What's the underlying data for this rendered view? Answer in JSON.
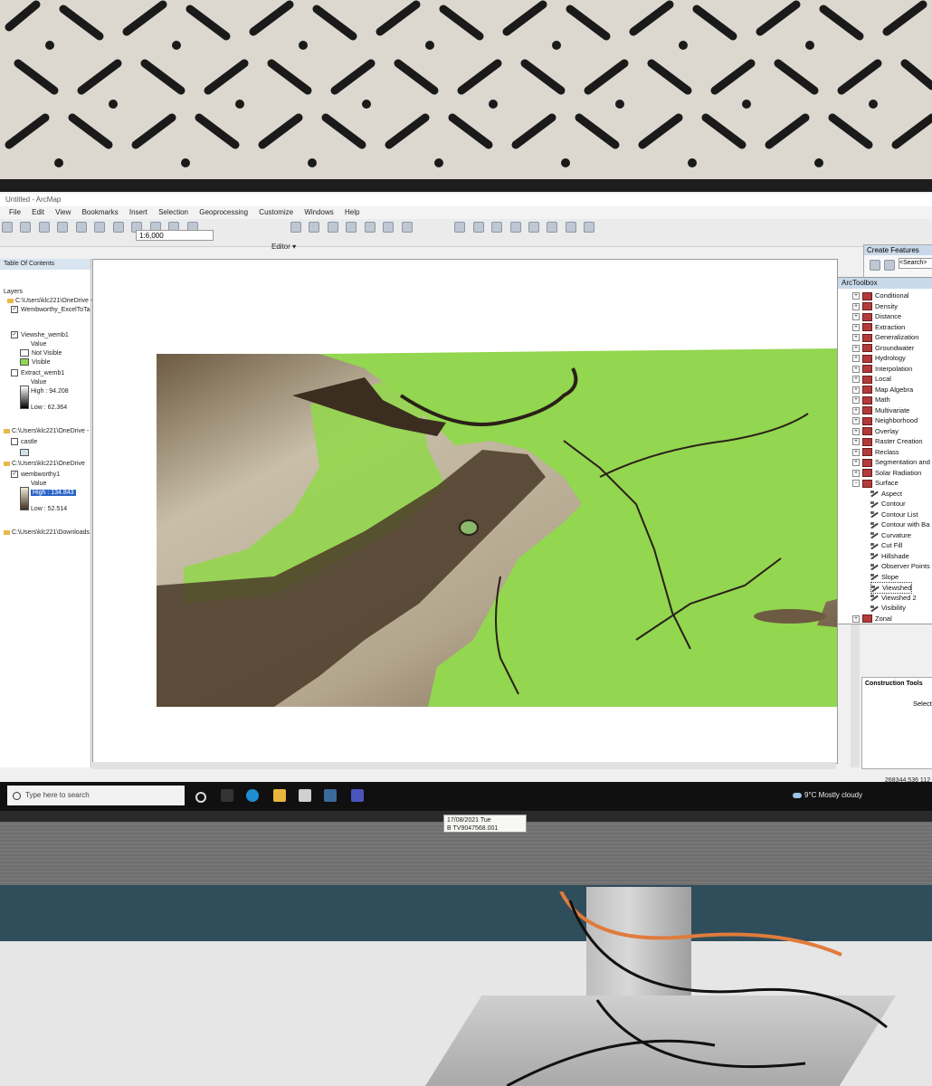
{
  "window": {
    "title": "Untitled - ArcMap",
    "menu": [
      "File",
      "Edit",
      "View",
      "Bookmarks",
      "Insert",
      "Selection",
      "Geoprocessing",
      "Customize",
      "Windows",
      "Help"
    ]
  },
  "toolbar": {
    "scale": "1:6,000",
    "editor_label": "Editor ▾"
  },
  "toc": {
    "title": "Table Of Contents",
    "layers_label": "Layers",
    "path1": "C:\\Users\\klc221\\OneDrive -",
    "layer1": "Wembworthy_ExcelToTa",
    "layer2": "Viewshe_wemb1",
    "layer2_value": "Value",
    "layer2_class1": "Not Visible",
    "layer2_class2": "Visible",
    "layer3": "Extract_wemb1",
    "layer3_value": "Value",
    "layer3_high": "High : 94.208",
    "layer3_low": "Low : 62.364",
    "path2": "C:\\Users\\klc221\\OneDrive -",
    "layer4": "castle",
    "path3": "C:\\Users\\klc221\\OneDrive",
    "layer5": "wembworthy1",
    "layer5_value": "Value",
    "layer5_high": "High : 134.843",
    "layer5_low": "Low : 52.514",
    "path4": "C:\\Users\\klc221\\Downloads"
  },
  "create_features": {
    "title": "Create Features",
    "search_placeholder": "<Search>"
  },
  "arctoolbox": {
    "title": "ArcToolbox",
    "toolsets": [
      "Conditional",
      "Density",
      "Distance",
      "Extraction",
      "Generalization",
      "Groundwater",
      "Hydrology",
      "Interpolation",
      "Local",
      "Map Algebra",
      "Math",
      "Multivariate",
      "Neighborhood",
      "Overlay",
      "Raster Creation",
      "Reclass",
      "Segmentation and C",
      "Solar Radiation",
      "Surface"
    ],
    "surface_tools": [
      "Aspect",
      "Contour",
      "Contour List",
      "Contour with Ba",
      "Curvature",
      "Cut Fill",
      "Hillshade",
      "Observer Points",
      "Slope",
      "Viewshed",
      "Viewshed 2",
      "Visibility"
    ],
    "last": "Zonal"
  },
  "construction_tools": {
    "title": "Construction Tools",
    "hint": "Select"
  },
  "status": {
    "coordinates": "268344.536  112"
  },
  "taskbar": {
    "search_placeholder": "Type here to search",
    "weather": "9°C  Mostly cloudy"
  },
  "sticker": {
    "line1": "17/08/2021 Tue",
    "line2": "B TV9047568.001"
  },
  "colors": {
    "visible_green": "#93d64f",
    "terrain_dark": "#4a3a28",
    "terrain_light": "#d8d0bf"
  }
}
